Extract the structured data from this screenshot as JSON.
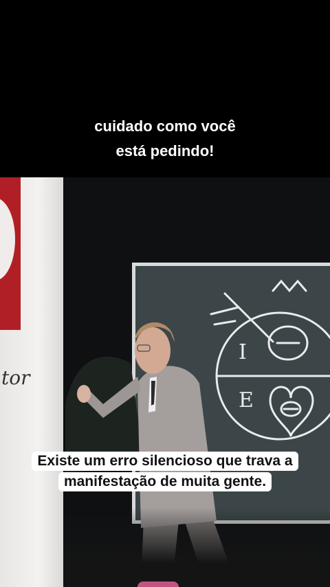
{
  "top_caption": {
    "line1": "cuidado como você",
    "line2": "está pedindo!"
  },
  "video": {
    "script_word": "tor",
    "subtitle": {
      "line1": "Existe um erro silencioso que trava a",
      "line2": "manifestação de muita gente."
    },
    "board_marks": [
      "I",
      "E"
    ]
  },
  "colors": {
    "background": "#000000",
    "caption_text": "#ffffff",
    "subtitle_bg": "#ffffff",
    "subtitle_text": "#111111",
    "board": "#3c4648",
    "panel_red": "#b01f26"
  }
}
